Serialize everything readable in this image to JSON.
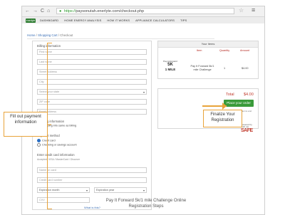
{
  "browser": {
    "nav_back": "←",
    "nav_forward": "→",
    "nav_reload": "C",
    "nav_home": "⌂",
    "url_scheme": "https://",
    "url_rest": "paysonutah.enerlyte.com/checkout.php",
    "star": "☆",
    "menu": "≡"
  },
  "site": {
    "logo_text": "enerlyte",
    "nav": [
      "DASHBOARD",
      "HOME ENERGY ANALYSIS",
      "HOW IT WORKS",
      "APPLIANCE CALCULATORS",
      "TIPS"
    ]
  },
  "breadcrumb": {
    "home": "Home",
    "cart": "Shopping Cart",
    "current": "Checkout"
  },
  "billing": {
    "title": "Billing information",
    "first_name": "First name",
    "last_name": "Last name",
    "street": "Street Address",
    "city": "City",
    "state": "Select your state",
    "zip": "ZIP code",
    "email": "Email address"
  },
  "shipping": {
    "title": "Shipping information",
    "option": "Shipping info same as billing"
  },
  "payment": {
    "title": "Payment method",
    "credit": "Credit card",
    "checking": "Checking or savings account"
  },
  "card": {
    "title": "Enter credit card information",
    "accepted": "Accepted: VISA / MasterCard / Discover",
    "name_on_card": "Name on card",
    "card_number": "Credit card number",
    "exp_month": "Expiration month",
    "exp_year": "Expiration year",
    "cvv": "CVV",
    "what_is_this": "What is this?"
  },
  "items": {
    "header": "Your items",
    "col_item": "Item",
    "col_qty": "Quantity",
    "col_amount": "Amount",
    "product_logo_top": "Pay-it-Forward",
    "product_logo_big": "5K",
    "product_logo_mile": "1 MILE",
    "product_desc": "Pay It Forward 5k/1 mile Challenge",
    "quantity": "1",
    "amount": "$4.00"
  },
  "totals": {
    "label": "Total",
    "value": "$4.00",
    "place_order": "Place your order",
    "agree_text": "By placing your order you agree to the terms and conditions"
  },
  "safe_badge": {
    "line1": "Powered by Auth.net",
    "line2": "SAFE"
  },
  "annotations": {
    "left": "Fill out payment information",
    "right": "Finalize Your Registration",
    "caption": "Pay It Forward 5k/1 mile Challenge Online Registration Steps"
  },
  "colors": {
    "accent_orange": "#e8a33a",
    "button_green": "#3a9b3a",
    "total_red": "#c0392b"
  }
}
